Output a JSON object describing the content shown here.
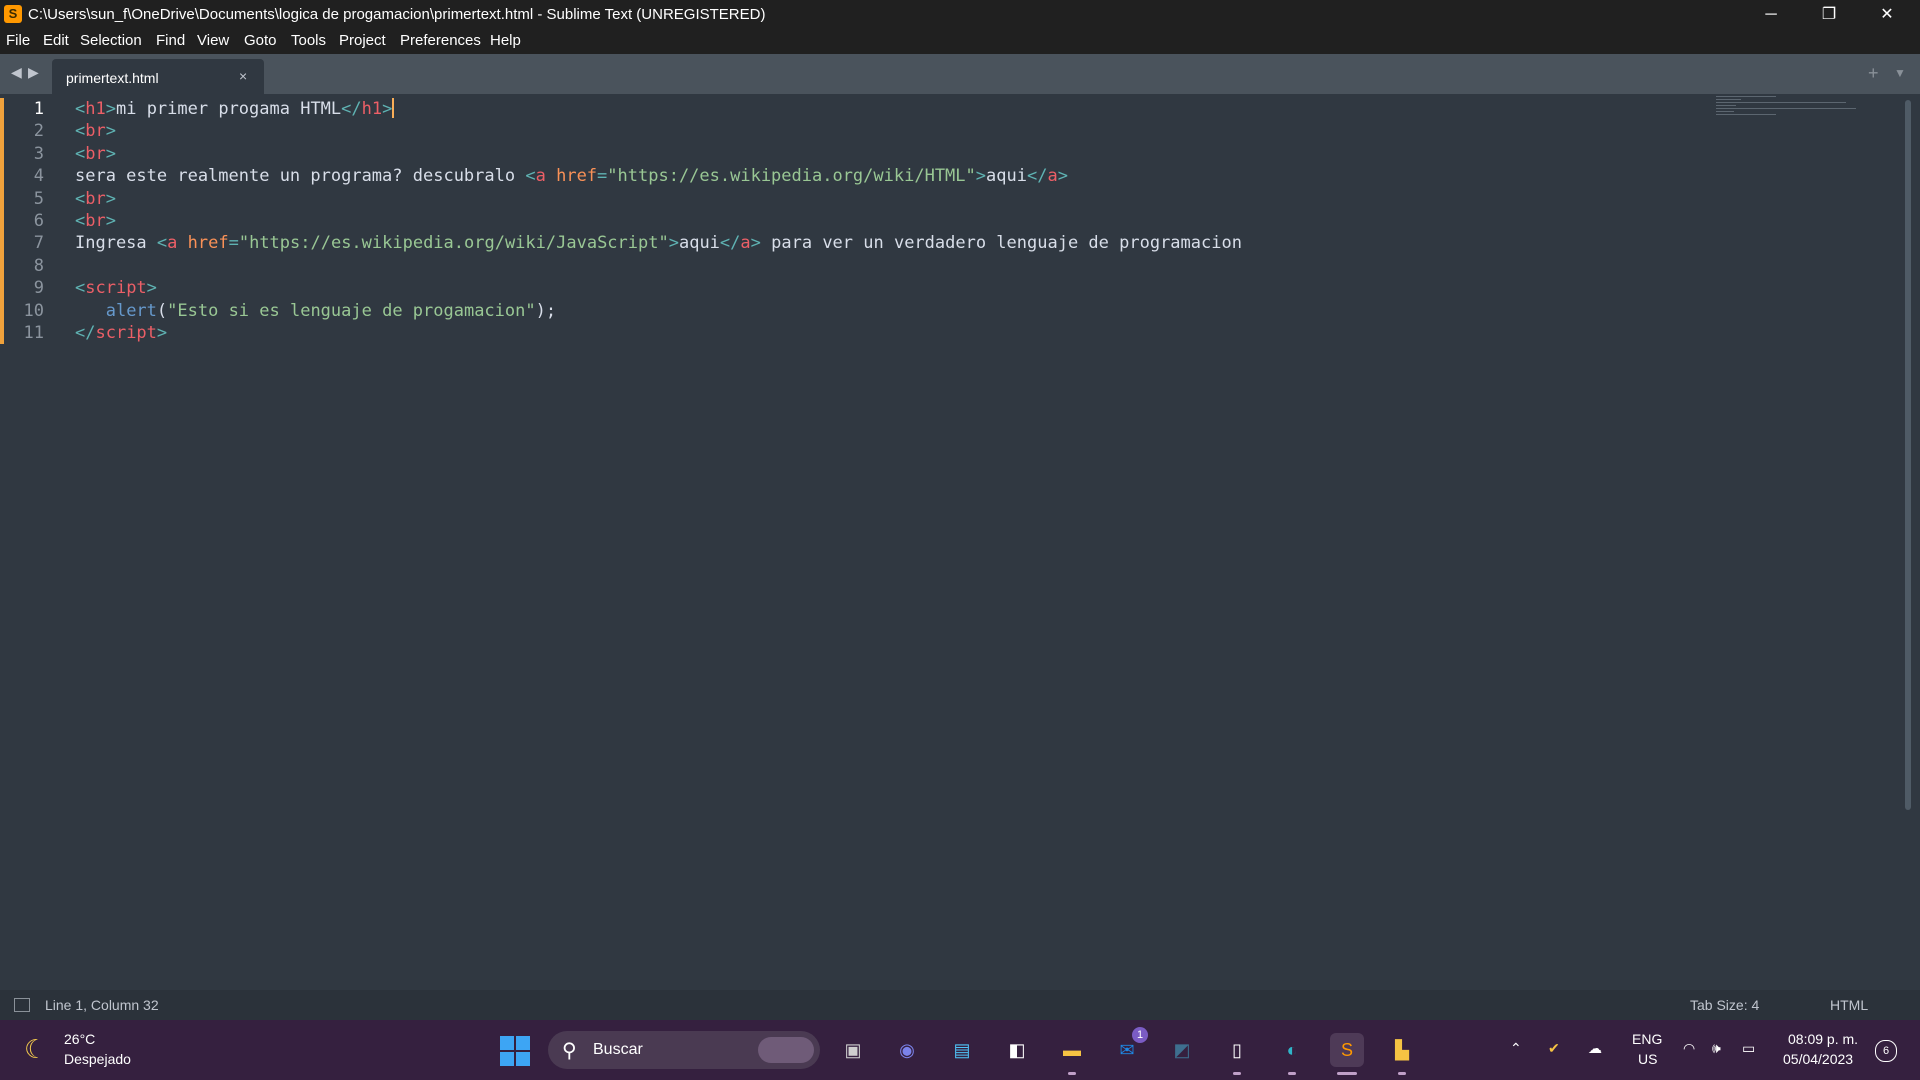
{
  "window": {
    "title": "C:\\Users\\sun_f\\OneDrive\\Documents\\logica de progamacion\\primertext.html - Sublime Text (UNREGISTERED)",
    "app_icon": "sublime-text-icon",
    "controls": {
      "minimize": "─",
      "restore": "❐",
      "close": "✕"
    }
  },
  "menu": [
    "File",
    "Edit",
    "Selection",
    "Find",
    "View",
    "Goto",
    "Tools",
    "Project",
    "Preferences",
    "Help"
  ],
  "tabs": {
    "nav_back": "◀",
    "nav_forward": "▶",
    "active": {
      "label": "primertext.html",
      "close": "×"
    },
    "new_tab": "+",
    "tab_menu": "▼"
  },
  "editor": {
    "active_line": 1,
    "lines": [
      {
        "num": "1",
        "tokens": [
          [
            "p",
            "<"
          ],
          [
            "tag",
            "h1"
          ],
          [
            "p",
            ">"
          ],
          [
            "text",
            "mi primer progama HTML"
          ],
          [
            "p",
            "</"
          ],
          [
            "tag",
            "h1"
          ],
          [
            "p",
            ">"
          ]
        ],
        "cursor": true
      },
      {
        "num": "2",
        "tokens": [
          [
            "p",
            "<"
          ],
          [
            "tag",
            "br"
          ],
          [
            "p",
            ">"
          ]
        ]
      },
      {
        "num": "3",
        "tokens": [
          [
            "p",
            "<"
          ],
          [
            "tag",
            "br"
          ],
          [
            "p",
            ">"
          ]
        ]
      },
      {
        "num": "4",
        "tokens": [
          [
            "text",
            "sera este realmente un programa? descubralo "
          ],
          [
            "p",
            "<"
          ],
          [
            "tag",
            "a"
          ],
          [
            "text",
            " "
          ],
          [
            "attr",
            "href"
          ],
          [
            "p",
            "="
          ],
          [
            "str",
            "\"https://es.wikipedia.org/wiki/HTML\""
          ],
          [
            "p",
            ">"
          ],
          [
            "text",
            "aqui"
          ],
          [
            "p",
            "</"
          ],
          [
            "tag",
            "a"
          ],
          [
            "p",
            ">"
          ]
        ]
      },
      {
        "num": "5",
        "tokens": [
          [
            "p",
            "<"
          ],
          [
            "tag",
            "br"
          ],
          [
            "p",
            ">"
          ]
        ]
      },
      {
        "num": "6",
        "tokens": [
          [
            "p",
            "<"
          ],
          [
            "tag",
            "br"
          ],
          [
            "p",
            ">"
          ]
        ]
      },
      {
        "num": "7",
        "tokens": [
          [
            "text",
            "Ingresa "
          ],
          [
            "p",
            "<"
          ],
          [
            "tag",
            "a"
          ],
          [
            "text",
            " "
          ],
          [
            "attr",
            "href"
          ],
          [
            "p",
            "="
          ],
          [
            "str",
            "\"https://es.wikipedia.org/wiki/JavaScript\""
          ],
          [
            "p",
            ">"
          ],
          [
            "text",
            "aqui"
          ],
          [
            "p",
            "</"
          ],
          [
            "tag",
            "a"
          ],
          [
            "p",
            ">"
          ],
          [
            "text",
            " para ver un verdadero lenguaje de programacion"
          ]
        ]
      },
      {
        "num": "8",
        "tokens": []
      },
      {
        "num": "9",
        "tokens": [
          [
            "p",
            "<"
          ],
          [
            "tag",
            "script"
          ],
          [
            "p",
            ">"
          ]
        ]
      },
      {
        "num": "10",
        "tokens": [
          [
            "text",
            "   "
          ],
          [
            "fn",
            "alert"
          ],
          [
            "text",
            "("
          ],
          [
            "str",
            "\"Esto si es lenguaje de progamacion\""
          ],
          [
            "text",
            ");"
          ]
        ]
      },
      {
        "num": "11",
        "tokens": [
          [
            "p",
            "</"
          ],
          [
            "tag",
            "script"
          ],
          [
            "p",
            ">"
          ]
        ]
      }
    ]
  },
  "status": {
    "cursor_position": "Line 1, Column 32",
    "tab_size": "Tab Size: 4",
    "syntax": "HTML"
  },
  "taskbar": {
    "weather": {
      "icon": "moon-icon",
      "temperature": "26°C",
      "condition": "Despejado"
    },
    "search_label": "Buscar",
    "apps": [
      {
        "name": "task-view-icon",
        "glyph": "▣",
        "color": "#cfcfcf"
      },
      {
        "name": "teams-chat-icon",
        "glyph": "◉",
        "color": "#7b83eb"
      },
      {
        "name": "notepad-icon",
        "glyph": "▤",
        "color": "#4fc3f7"
      },
      {
        "name": "microsoft-store-icon",
        "glyph": "◧",
        "color": "#ffffff"
      },
      {
        "name": "file-explorer-icon",
        "glyph": "▬",
        "color": "#f6c343"
      },
      {
        "name": "outlook-icon",
        "glyph": "✉",
        "color": "#1e88e5",
        "badge": "1"
      },
      {
        "name": "mysql-workbench-icon",
        "glyph": "◩",
        "color": "#3e6f8f"
      },
      {
        "name": "blank-file-icon",
        "glyph": "▯",
        "color": "#ffffff"
      },
      {
        "name": "edge-browser-icon",
        "glyph": "◐",
        "color": "#2fb5c9"
      },
      {
        "name": "sublime-text-taskbar-icon",
        "glyph": "S",
        "color": "#ff9800"
      },
      {
        "name": "file-manager-icon",
        "glyph": "▙",
        "color": "#f6c343"
      }
    ],
    "tray": {
      "chevron": "⌃",
      "wifi": "wifi-icon",
      "volume": "volume-icon",
      "battery": "battery-icon"
    },
    "language": {
      "line1": "ENG",
      "line2": "US"
    },
    "clock": {
      "time": "08:09 p. m.",
      "date": "05/04/2023"
    },
    "notifications": "6"
  }
}
